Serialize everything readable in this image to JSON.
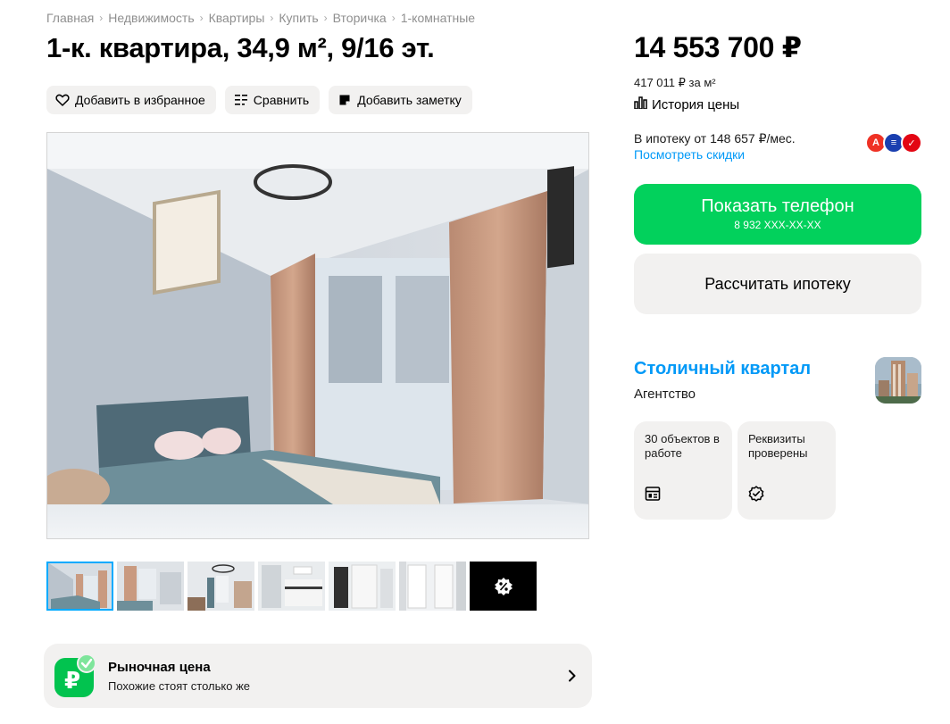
{
  "breadcrumbs": [
    "Главная",
    "Недвижимость",
    "Квартиры",
    "Купить",
    "Вторичка",
    "1-комнатные"
  ],
  "title": "1-к. квартира, 34,9 м², 9/16 эт.",
  "actions": {
    "favorite": "Добавить в избранное",
    "compare": "Сравнить",
    "note": "Добавить заметку"
  },
  "gallery": {
    "main_photo_subject": "bedroom",
    "thumbnails": [
      "bedroom",
      "bedroom-view",
      "living-room",
      "kitchen",
      "hallway",
      "hallway-2",
      "more-photos"
    ]
  },
  "market_price": {
    "title": "Рыночная цена",
    "subtitle": "Похожие стоят столько же"
  },
  "price": {
    "total": "14 553 700 ₽",
    "per_meter": "417 011 ₽ за м²",
    "history_label": "История цены"
  },
  "mortgage": {
    "text": "В ипотеку от 148 657 ₽/мес.",
    "discounts_link": "Посмотреть скидки",
    "banks": [
      {
        "name": "alfa-bank-logo",
        "letter": "А",
        "color": "#ef3124"
      },
      {
        "name": "bank-logo-blue",
        "letter": "≡",
        "color": "#1a3fb0"
      },
      {
        "name": "bank-logo-red",
        "letter": "✓",
        "color": "#e30613"
      }
    ]
  },
  "contact": {
    "show_phone": "Показать телефон",
    "phone_masked": "8 932 XXX-XX-XX",
    "calc_mortgage": "Рассчитать ипотеку"
  },
  "seller": {
    "name": "Столичный квартал",
    "type": "Агентство",
    "badges": [
      {
        "text": "30 объектов в работе",
        "icon": "listing-icon"
      },
      {
        "text": "Реквизиты проверены",
        "icon": "verified-check-icon"
      }
    ]
  },
  "colors": {
    "accent_green": "#02d15c",
    "link_blue": "#0099f7",
    "surface_gray": "#f2f1f0"
  }
}
